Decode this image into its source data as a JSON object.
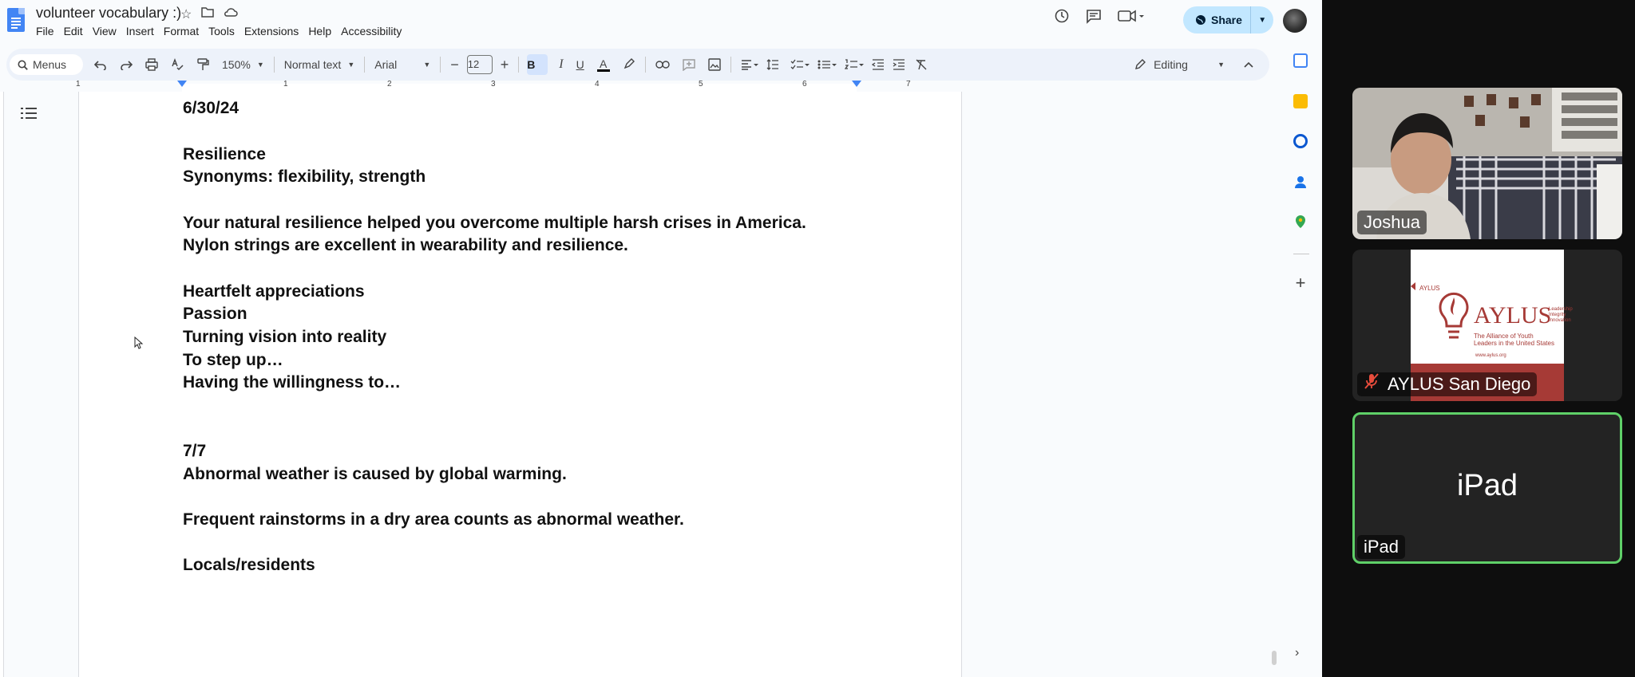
{
  "doc": {
    "title": "volunteer vocabulary :)",
    "menus": [
      "File",
      "Edit",
      "View",
      "Insert",
      "Format",
      "Tools",
      "Extensions",
      "Help",
      "Accessibility"
    ],
    "share_label": "Share"
  },
  "toolbar": {
    "search_label": "Menus",
    "zoom": "150%",
    "style": "Normal text",
    "font": "Arial",
    "font_size": "12",
    "bold": "B",
    "italic": "I",
    "underline": "U",
    "text_color": "A",
    "mode": "Editing"
  },
  "ruler": {
    "numbers": [
      "1",
      "1",
      "2",
      "3",
      "4",
      "5",
      "6",
      "7"
    ]
  },
  "content": {
    "lines": [
      "6/30/24",
      "Resilience",
      "Synonyms: flexibility, strength",
      "Your natural resilience helped you overcome multiple harsh crises in America.",
      "Nylon strings are excellent in wearability and resilience.",
      "Heartfelt appreciations",
      "Passion",
      "Turning vision into reality",
      "To step up…",
      "Having the willingness to…",
      "7/7",
      "Abnormal weather is caused by global warming.",
      "Frequent rainstorms in a dry area counts as abnormal weather.",
      "Locals/residents"
    ]
  },
  "meeting": {
    "participants": [
      {
        "name": "Joshua"
      },
      {
        "name": "AYLUS San Diego",
        "muted": true
      },
      {
        "name": "iPad",
        "big_label": "iPad",
        "active_speaker": true
      }
    ],
    "slide": {
      "small_header": "AYLUS",
      "logo_text": "AYLUS",
      "tagline_words": [
        "Leadership",
        "Integrity",
        "Innovation"
      ],
      "subtitle": "The Alliance of Youth Leaders in the United States",
      "url": "www.aylus.org"
    },
    "colors": {
      "active_border": "#5fd068",
      "brand_red": "#a63a36",
      "muted_icon": "#e74c3c"
    }
  },
  "icons": [
    "docs-logo-icon",
    "star-icon",
    "move-folder-icon",
    "cloud-status-icon",
    "history-icon",
    "comment-icon",
    "meet-icon",
    "globe-icon",
    "undo-icon",
    "redo-icon",
    "print-icon",
    "spellcheck-icon",
    "paint-format-icon",
    "link-icon",
    "add-comment-icon",
    "image-icon",
    "align-icon",
    "line-spacing-icon",
    "checklist-icon",
    "bullet-list-icon",
    "numbered-list-icon",
    "indent-decrease-icon",
    "indent-increase-icon",
    "clear-format-icon",
    "pencil-icon",
    "outline-icon",
    "calendar-icon",
    "keep-icon",
    "tasks-icon",
    "contacts-icon",
    "maps-icon",
    "plus-icon",
    "mic-off-icon"
  ]
}
